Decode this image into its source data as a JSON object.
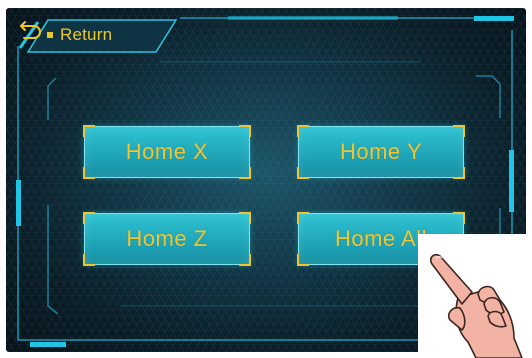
{
  "return_button": {
    "label": "Return",
    "icon": "return-arrow-icon"
  },
  "buttons": {
    "home_x": "Home X",
    "home_y": "Home Y",
    "home_z": "Home Z",
    "home_all": "Home All"
  },
  "overlay": {
    "icon": "pointing-hand-icon"
  },
  "colors": {
    "accent_cyan": "#29c6dc",
    "text_yellow": "#f0c52b",
    "background_dark": "#0a1c25",
    "button_fill": "#22aabc"
  }
}
